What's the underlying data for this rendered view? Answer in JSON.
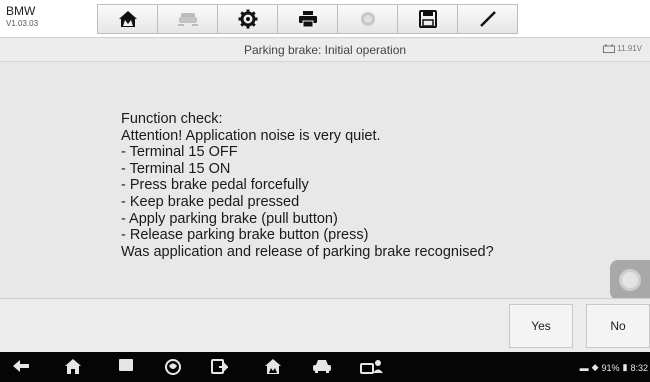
{
  "header": {
    "brand": "BMW",
    "version": "V1.03.03"
  },
  "toolbar": {
    "items": [
      {
        "icon": "home-icon"
      },
      {
        "icon": "vehicle-swap-icon"
      },
      {
        "icon": "gear-icon"
      },
      {
        "icon": "printer-icon"
      },
      {
        "icon": "help-icon"
      },
      {
        "icon": "save-icon"
      },
      {
        "icon": "pen-icon"
      }
    ]
  },
  "titlebar": {
    "title": "Parking brake: Initial operation",
    "battery": "11.91V"
  },
  "message": {
    "lines": [
      "Function check:",
      "Attention! Application noise is very quiet.",
      "- Terminal 15 OFF",
      "- Terminal 15 ON",
      "- Press brake pedal forcefully",
      "- Keep brake pedal pressed",
      "- Apply parking brake (pull button)",
      "- Release parking brake button (press)",
      "Was application and release of parking brake recognised?"
    ]
  },
  "actions": {
    "yes": "Yes",
    "no": "No"
  },
  "navbar": {
    "icons": [
      "back-icon",
      "home-icon",
      "recent-apps-icon",
      "browser-icon",
      "vci-icon",
      "diag-home-icon",
      "car-icon",
      "technician-icon"
    ],
    "status": {
      "battery": "91%",
      "time": "8:32"
    }
  },
  "colors": {
    "toolbar_bg": "#f2f2f2",
    "content_bg": "#e8e8e8",
    "navbar_bg": "#050505"
  }
}
